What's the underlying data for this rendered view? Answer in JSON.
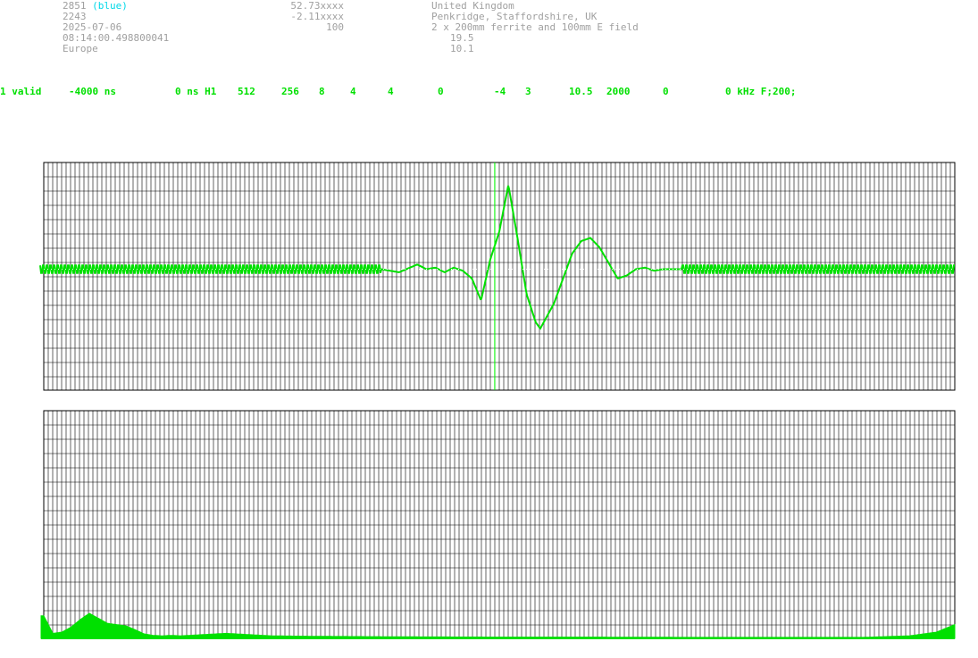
{
  "info": {
    "col1": [
      "2851",
      "2243",
      "2025-07-06",
      "08:14:00.498800041",
      "Europe"
    ],
    "col1_tag": "(blue)",
    "col2": [
      "52.73xxxx",
      "-2.11xxxx",
      "100"
    ],
    "col3": [
      "United Kingdom",
      "Penkridge, Staffordshire, UK",
      "2 x 200mm ferrite and 100mm E field",
      "19.5",
      "10.1"
    ]
  },
  "status": [
    "1 valid",
    "-4000 ns",
    "0 ns H1",
    "512",
    "256",
    "8",
    "4",
    "4",
    "0",
    "-4",
    "3",
    "10.5",
    "2000",
    "0",
    "0 kHz F;200;"
  ],
  "colors": {
    "grid": "#000000",
    "trace": "#00e000",
    "marker": "#00ff00",
    "text": "#a0a0a0",
    "accent": "#00d8e8"
  },
  "chart_data": [
    {
      "type": "line",
      "name": "waveform",
      "grid": true,
      "noise_amplitude": 0.12,
      "x": [
        0.0,
        0.37,
        0.39,
        0.41,
        0.42,
        0.43,
        0.44,
        0.45,
        0.46,
        0.47,
        0.48,
        0.49,
        0.5,
        0.51,
        0.52,
        0.53,
        0.54,
        0.545,
        0.56,
        0.57,
        0.58,
        0.59,
        0.6,
        0.61,
        0.62,
        0.63,
        0.64,
        0.65,
        0.66,
        0.67,
        0.68,
        0.7,
        1.0
      ],
      "y": [
        0.0,
        0.0,
        -0.1,
        0.15,
        0.0,
        0.05,
        -0.1,
        0.05,
        -0.05,
        -0.3,
        -1.0,
        0.3,
        1.2,
        2.7,
        1.0,
        -0.8,
        -1.7,
        -1.9,
        -1.1,
        -0.3,
        0.5,
        0.9,
        1.0,
        0.7,
        0.2,
        -0.3,
        -0.2,
        0.0,
        0.05,
        -0.05,
        0.0,
        0.0,
        0.0
      ]
    },
    {
      "type": "area",
      "name": "spectrum",
      "grid": true,
      "x": [
        0.0,
        0.01,
        0.02,
        0.03,
        0.04,
        0.05,
        0.06,
        0.07,
        0.08,
        0.09,
        0.1,
        0.11,
        0.12,
        0.13,
        0.14,
        0.15,
        0.2,
        0.25,
        0.3,
        0.4,
        0.5,
        0.6,
        0.7,
        0.8,
        0.9,
        0.95,
        0.98,
        1.0
      ],
      "y": [
        0.9,
        0.2,
        0.25,
        0.45,
        0.75,
        1.0,
        0.8,
        0.6,
        0.55,
        0.5,
        0.35,
        0.18,
        0.12,
        0.1,
        0.12,
        0.1,
        0.2,
        0.1,
        0.08,
        0.06,
        0.05,
        0.05,
        0.04,
        0.04,
        0.04,
        0.1,
        0.25,
        0.55
      ]
    }
  ]
}
